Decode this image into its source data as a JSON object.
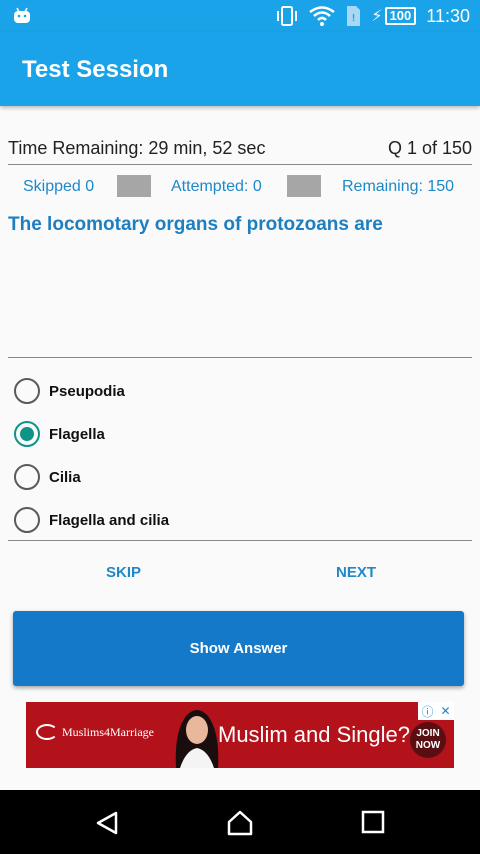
{
  "status_bar": {
    "time": "11:30",
    "battery": "100",
    "icons": [
      "android-icon",
      "vibrate-icon",
      "wifi-icon",
      "sim-icon",
      "charging-icon",
      "battery-icon"
    ]
  },
  "app_bar": {
    "title": "Test Session"
  },
  "session": {
    "time_remaining": "Time Remaining: 29 min, 52 sec",
    "question_counter": "Q 1 of 150",
    "skipped": "Skipped 0",
    "attempted": "Attempted: 0",
    "remaining": "Remaining: 150"
  },
  "question": {
    "text": "The locomotary organs of protozoans are",
    "options": [
      {
        "label": "Pseupodia",
        "selected": false
      },
      {
        "label": "Flagella",
        "selected": true
      },
      {
        "label": "Cilia",
        "selected": false
      },
      {
        "label": "Flagella and cilia",
        "selected": false
      }
    ]
  },
  "actions": {
    "skip": "SKIP",
    "next": "NEXT",
    "show_answer": "Show Answer"
  },
  "ad": {
    "brand": "Muslims4Marriage",
    "headline": "Muslim and Single?",
    "cta_line1": "JOIN",
    "cta_line2": "NOW"
  },
  "colors": {
    "primary": "#1aa3e8",
    "accent": "#1e88c8",
    "button": "#1479c9",
    "radio_checked": "#0f9488",
    "ad_background": "#b3121b"
  }
}
